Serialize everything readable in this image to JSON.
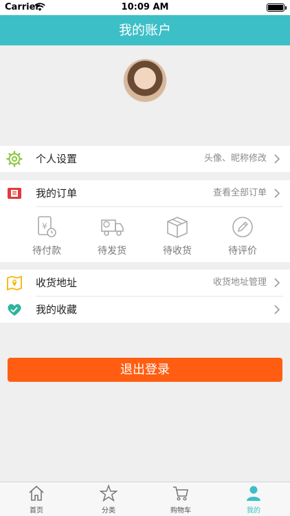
{
  "status_bar": {
    "carrier": "Carrier",
    "time": "10:09 AM"
  },
  "nav": {
    "title": "我的账户"
  },
  "menu": {
    "settings": {
      "label": "个人设置",
      "hint": "头像、昵称修改"
    },
    "orders": {
      "label": "我的订单",
      "hint": "查看全部订单"
    },
    "order_states": [
      {
        "label": "待付款",
        "icon": "wallet-yen-icon"
      },
      {
        "label": "待发货",
        "icon": "delivery-truck-icon"
      },
      {
        "label": "待收货",
        "icon": "package-box-icon"
      },
      {
        "label": "待评价",
        "icon": "edit-pencil-icon"
      }
    ],
    "address": {
      "label": "收货地址",
      "hint": "收货地址管理"
    },
    "favorites": {
      "label": "我的收藏",
      "hint": ""
    }
  },
  "logout": {
    "label": "退出登录"
  },
  "tabs": [
    {
      "label": "首页",
      "icon": "home-icon"
    },
    {
      "label": "分类",
      "icon": "star-icon"
    },
    {
      "label": "购物车",
      "icon": "cart-icon"
    },
    {
      "label": "我的",
      "icon": "user-icon",
      "active": true
    }
  ],
  "colors": {
    "accent": "#3dbfc7",
    "logout": "#ff5e12",
    "settings_icon": "#8cc63f",
    "orders_icon": "#e2393b",
    "address_icon": "#f7b500",
    "favorites_icon": "#2fb49b"
  }
}
